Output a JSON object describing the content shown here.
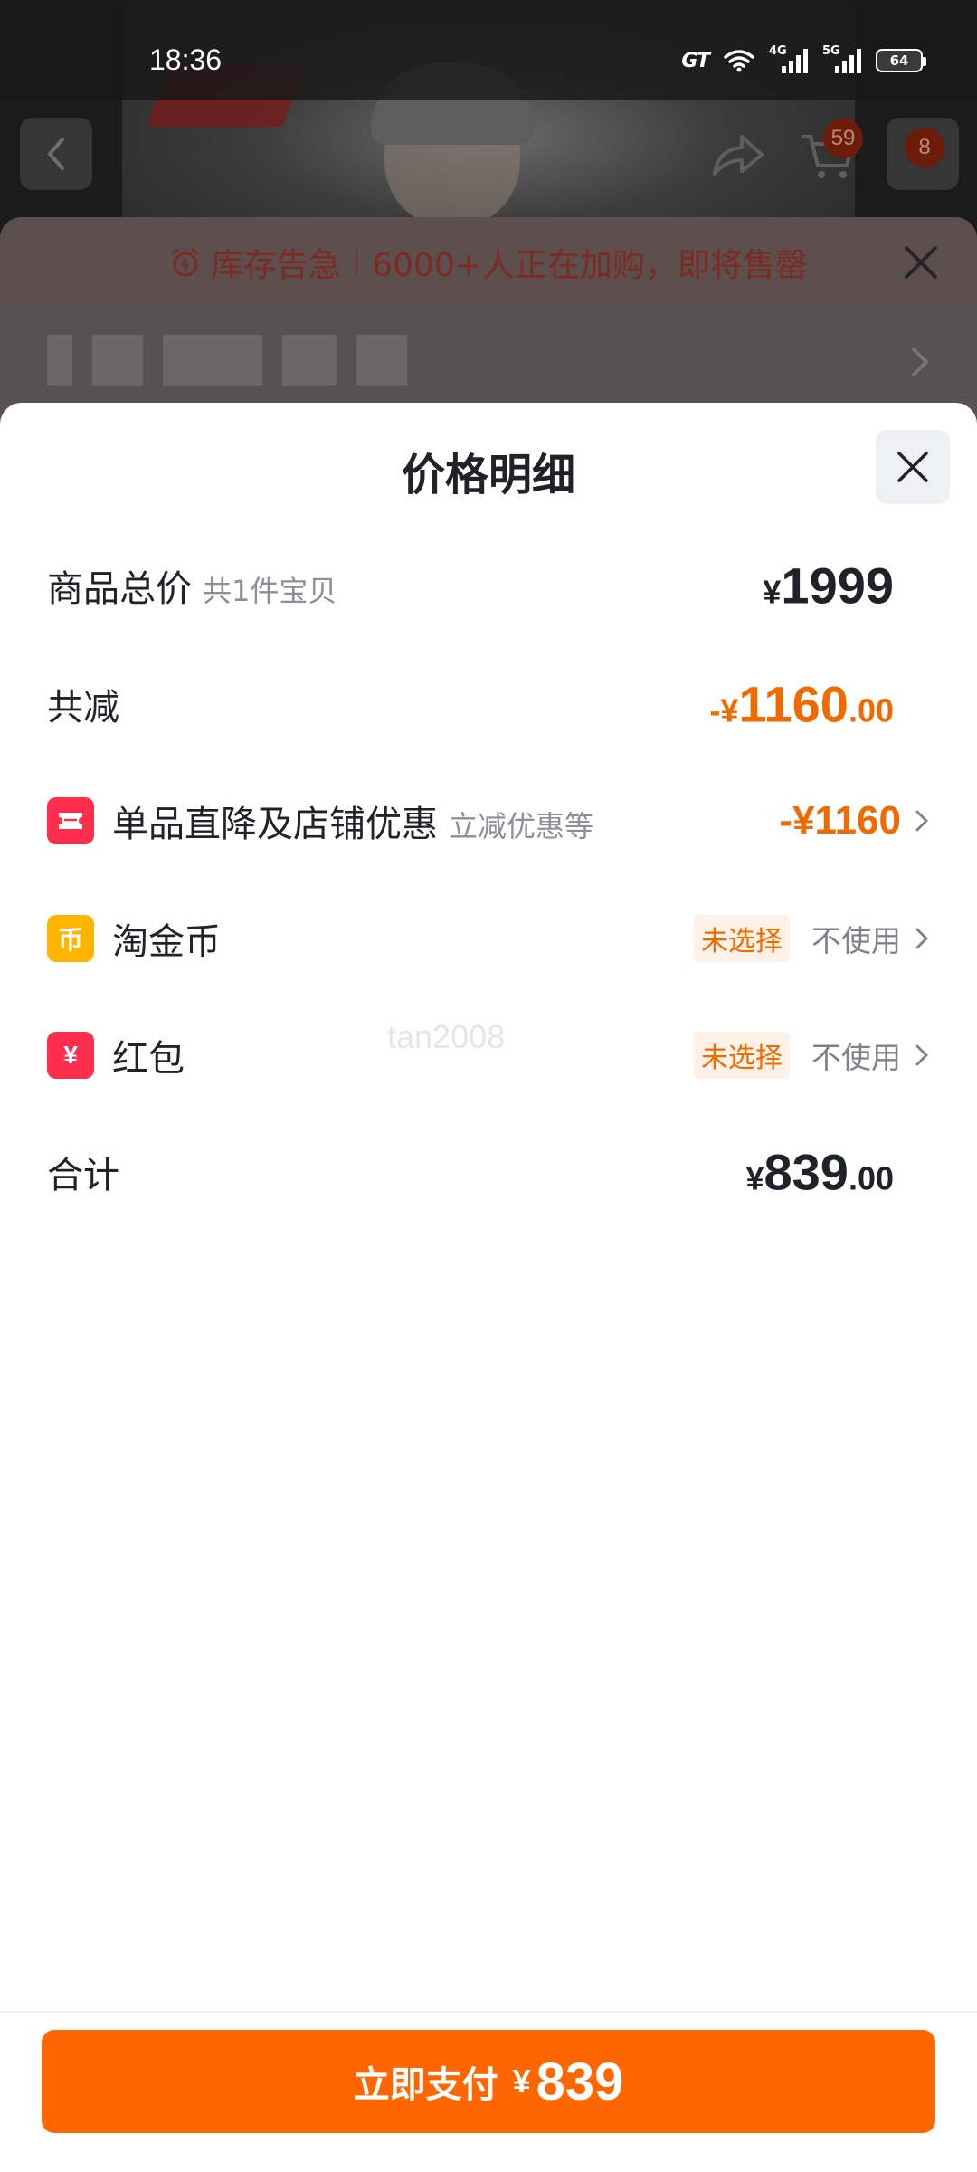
{
  "status_bar": {
    "time": "18:36",
    "battery": "64",
    "network_1": "4G",
    "network_2": "5G"
  },
  "nav": {
    "cart_badge": "59",
    "more_badge": "8"
  },
  "stock_banner": {
    "title": "库存告急",
    "message": "6000+人正在加购，即将售罄"
  },
  "sheet": {
    "title": "价格明细",
    "rows": {
      "subtotal": {
        "label": "商品总价",
        "sub": "共1件宝贝",
        "currency": "¥",
        "amount": "1999"
      },
      "total_discount": {
        "label": "共减",
        "prefix": "-¥",
        "amount": "1160",
        "decimals": ".00"
      },
      "direct_discount": {
        "label": "单品直降及店铺优惠",
        "sub": "立减优惠等",
        "value": "-¥1160"
      },
      "coins": {
        "label": "淘金币",
        "icon_glyph": "币",
        "status": "未选择",
        "action": "不使用"
      },
      "red_packet": {
        "label": "红包",
        "icon_glyph": "¥",
        "status": "未选择",
        "action": "不使用"
      },
      "total": {
        "label": "合计",
        "currency": "¥",
        "amount": "839",
        "decimals": ".00"
      }
    },
    "watermark": "tan2008"
  },
  "pay_button": {
    "label": "立即支付",
    "currency": "¥",
    "amount": "839"
  },
  "colors": {
    "accent": "#ff6600",
    "discount": "#f06a00",
    "icon_red": "#ff2e4d",
    "icon_gold": "#ffb400"
  }
}
